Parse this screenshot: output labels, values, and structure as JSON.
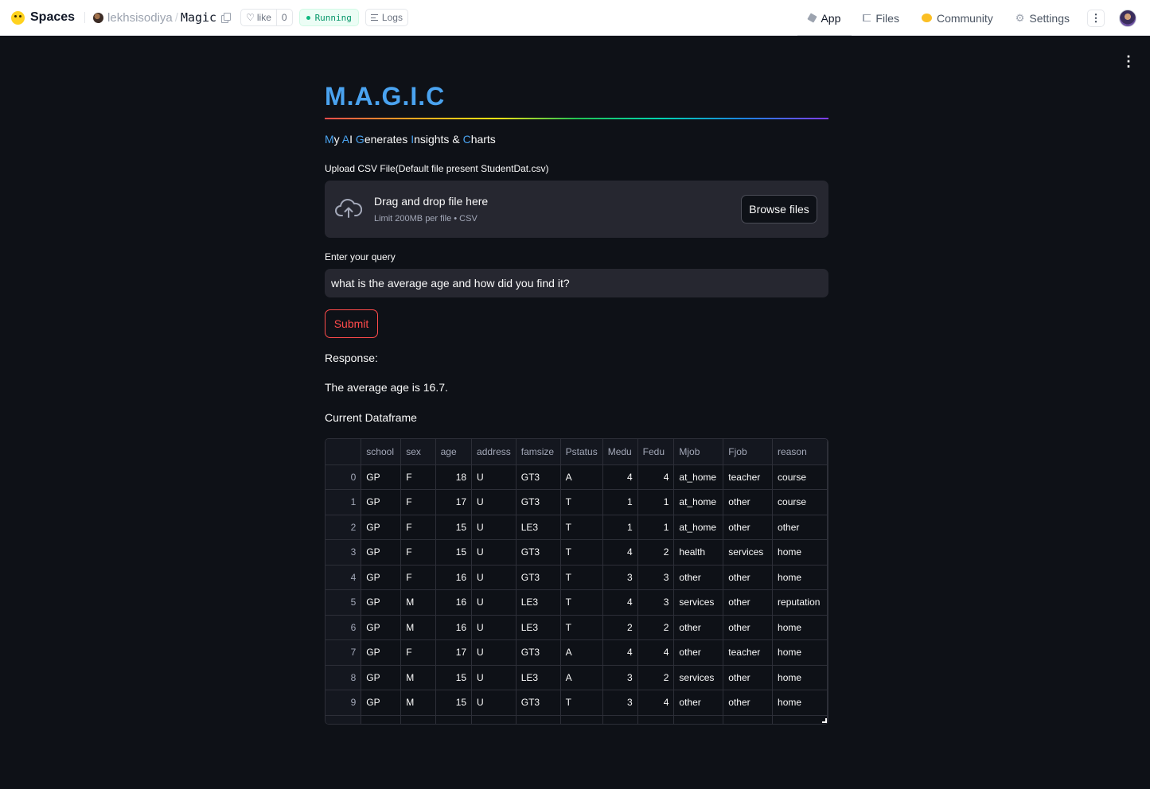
{
  "header": {
    "brand": "Spaces",
    "owner": "lekhsisodiya",
    "path_separator": "/",
    "repo": "Magic",
    "like_label": "like",
    "like_count": "0",
    "status": "Running",
    "logs_label": "Logs",
    "nav": [
      {
        "label": "App",
        "icon": "app-cube-icon"
      },
      {
        "label": "Files",
        "icon": "files-icon"
      },
      {
        "label": "Community",
        "icon": "community-icon"
      },
      {
        "label": "Settings",
        "icon": "gear-icon"
      }
    ],
    "more_glyph": "⋮"
  },
  "app": {
    "menu_glyph": "⋮",
    "title": "M.A.G.I.C",
    "subtitle_parts": [
      {
        "text": "M",
        "hl": true
      },
      {
        "text": "y ",
        "hl": false
      },
      {
        "text": "A",
        "hl": true
      },
      {
        "text": "I ",
        "hl": false
      },
      {
        "text": "G",
        "hl": true
      },
      {
        "text": "enerates ",
        "hl": false
      },
      {
        "text": "I",
        "hl": true
      },
      {
        "text": "nsights & ",
        "hl": false
      },
      {
        "text": "C",
        "hl": true
      },
      {
        "text": "harts",
        "hl": false
      }
    ],
    "upload_label": "Upload CSV File(Default file present StudentDat.csv)",
    "dropzone_title": "Drag and drop file here",
    "dropzone_sub": "Limit 200MB per file • CSV",
    "browse_label": "Browse files",
    "query_label": "Enter your query",
    "query_value": "what is the average age and how did you find it?",
    "submit_label": "Submit",
    "response_label": "Response:",
    "response_text": "The average age is 16.7.",
    "dataframe_label": "Current Dataframe"
  },
  "dataframe": {
    "columns": [
      "",
      "school",
      "sex",
      "age",
      "address",
      "famsize",
      "Pstatus",
      "Medu",
      "Fedu",
      "Mjob",
      "Fjob",
      "reason"
    ],
    "numeric": [
      true,
      false,
      false,
      true,
      false,
      false,
      false,
      true,
      true,
      false,
      false,
      false
    ],
    "rows": [
      [
        "0",
        "GP",
        "F",
        "18",
        "U",
        "GT3",
        "A",
        "4",
        "4",
        "at_home",
        "teacher",
        "course"
      ],
      [
        "1",
        "GP",
        "F",
        "17",
        "U",
        "GT3",
        "T",
        "1",
        "1",
        "at_home",
        "other",
        "course"
      ],
      [
        "2",
        "GP",
        "F",
        "15",
        "U",
        "LE3",
        "T",
        "1",
        "1",
        "at_home",
        "other",
        "other"
      ],
      [
        "3",
        "GP",
        "F",
        "15",
        "U",
        "GT3",
        "T",
        "4",
        "2",
        "health",
        "services",
        "home"
      ],
      [
        "4",
        "GP",
        "F",
        "16",
        "U",
        "GT3",
        "T",
        "3",
        "3",
        "other",
        "other",
        "home"
      ],
      [
        "5",
        "GP",
        "M",
        "16",
        "U",
        "LE3",
        "T",
        "4",
        "3",
        "services",
        "other",
        "reputation"
      ],
      [
        "6",
        "GP",
        "M",
        "16",
        "U",
        "LE3",
        "T",
        "2",
        "2",
        "other",
        "other",
        "home"
      ],
      [
        "7",
        "GP",
        "F",
        "17",
        "U",
        "GT3",
        "A",
        "4",
        "4",
        "other",
        "teacher",
        "home"
      ],
      [
        "8",
        "GP",
        "M",
        "15",
        "U",
        "LE3",
        "A",
        "3",
        "2",
        "services",
        "other",
        "home"
      ],
      [
        "9",
        "GP",
        "M",
        "15",
        "U",
        "GT3",
        "T",
        "3",
        "4",
        "other",
        "other",
        "home"
      ],
      [
        "",
        "",
        "",
        "",
        "",
        "",
        "",
        "",
        "",
        "",
        "",
        ""
      ]
    ]
  },
  "colors": {
    "accent_blue": "#4aa3f0",
    "submit_red": "#ff4b4b",
    "background": "#0e1117",
    "widget_bg": "#262730",
    "running_green": "#10b981"
  }
}
